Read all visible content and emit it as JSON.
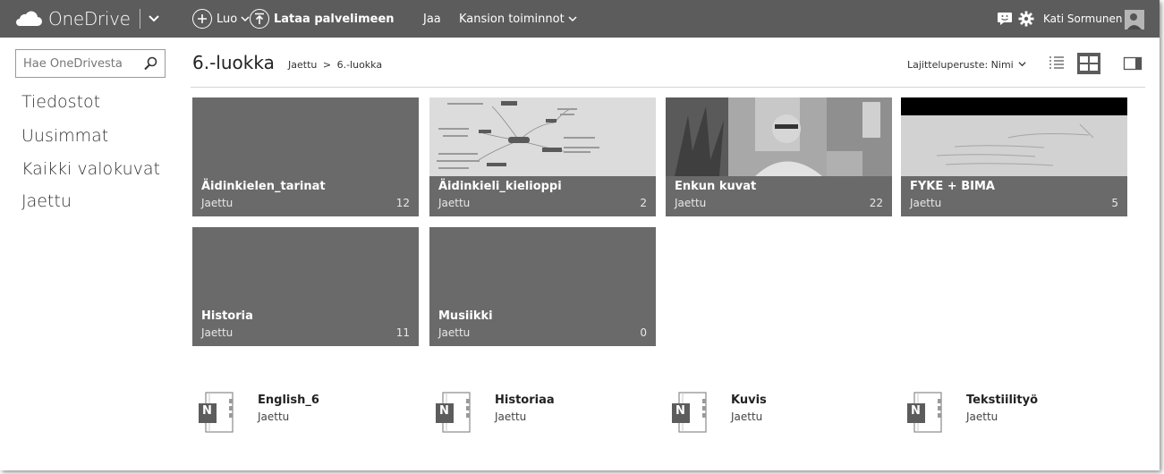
{
  "topbar": {
    "app_name": "OneDrive",
    "create_label": "Luo",
    "upload_label": "Lataa palvelimeen",
    "share_label": "Jaa",
    "folder_actions_label": "Kansion toiminnot",
    "user_name": "Kati Sormunen",
    "background_color": "#5c5c5c"
  },
  "search": {
    "placeholder": "Hae OneDrivesta"
  },
  "nav": {
    "items": [
      {
        "label": "Tiedostot"
      },
      {
        "label": "Uusimmat"
      },
      {
        "label": "Kaikki valokuvat"
      },
      {
        "label": "Jaettu"
      }
    ]
  },
  "header": {
    "title": "6.-luokka",
    "breadcrumb_root": "Jaettu",
    "breadcrumb_sep": ">",
    "breadcrumb_current": "6.-luokka",
    "sort_label": "Lajitteluperuste: Nimi"
  },
  "folders": [
    {
      "name": "Äidinkielen_tarinat",
      "sub": "Jaettu",
      "count": "12"
    },
    {
      "name": "Äidinkieli_kielioppi",
      "sub": "Jaettu",
      "count": "2"
    },
    {
      "name": "Enkun kuvat",
      "sub": "Jaettu",
      "count": "22"
    },
    {
      "name": "FYKE + BIMA",
      "sub": "Jaettu",
      "count": "5"
    },
    {
      "name": "Historia",
      "sub": "Jaettu",
      "count": "11"
    },
    {
      "name": "Musiikki",
      "sub": "Jaettu",
      "count": "0"
    }
  ],
  "notebooks": [
    {
      "name": "English_6",
      "sub": "Jaettu",
      "icon_letter": "N"
    },
    {
      "name": "Historiaa",
      "sub": "Jaettu",
      "icon_letter": "N"
    },
    {
      "name": "Kuvis",
      "sub": "Jaettu",
      "icon_letter": "N"
    },
    {
      "name": "Tekstiilityö",
      "sub": "Jaettu",
      "icon_letter": "N"
    }
  ],
  "icons": {
    "brand": "cloud-icon",
    "create": "plus-circle-icon",
    "upload": "upload-circle-icon",
    "feedback": "smiley-feedback-icon",
    "settings": "gear-icon",
    "search": "search-icon",
    "list_view": "list-view-icon",
    "tile_view": "tile-view-icon",
    "details_pane": "details-pane-icon",
    "notebook": "onenote-notebook-icon"
  }
}
